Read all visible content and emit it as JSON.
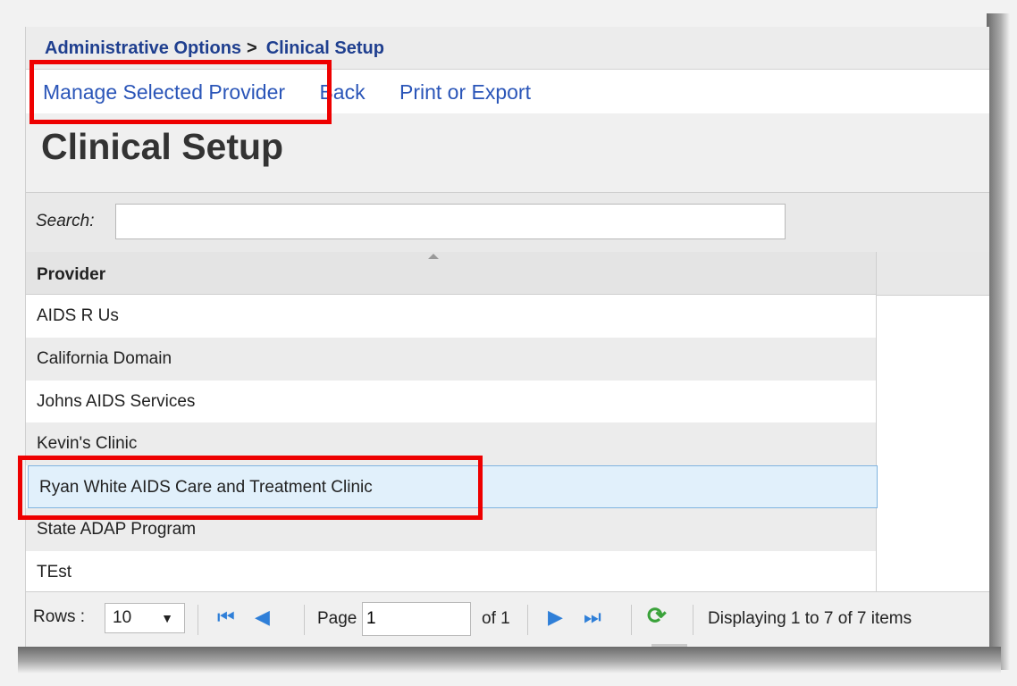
{
  "breadcrumb": {
    "parent": "Administrative Options",
    "separator": ">",
    "current": "Clinical Setup"
  },
  "actions": {
    "manage": "Manage Selected Provider",
    "back": "Back",
    "print": "Print or Export"
  },
  "page_title": "Clinical Setup",
  "search": {
    "label": "Search:",
    "value": ""
  },
  "grid": {
    "column_header": "Provider",
    "rows": [
      "AIDS R Us",
      "California Domain",
      "Johns AIDS Services",
      "Kevin's Clinic",
      "Ryan White AIDS Care and Treatment Clinic",
      "State ADAP Program",
      "TEst"
    ],
    "selected_row": "Ryan White AIDS Care and Treatment Clinic"
  },
  "pager": {
    "rows_label": "Rows :",
    "rows_value": "10",
    "page_label": "Page",
    "page_value": "1",
    "of_label": "of 1",
    "status": "Displaying 1 to 7 of 7 items"
  },
  "colors": {
    "link": "#2a55b8",
    "breadcrumb": "#1f3f8f",
    "highlight": "#ee0000",
    "selected_row": "#e1f0fb",
    "nav_icon": "#2f7fd8",
    "refresh_icon": "#3aa23a"
  },
  "icons": [
    "sort-arrow-icon",
    "first-page-icon",
    "previous-page-icon",
    "next-page-icon",
    "last-page-icon",
    "refresh-icon",
    "dropdown-caret-icon"
  ]
}
